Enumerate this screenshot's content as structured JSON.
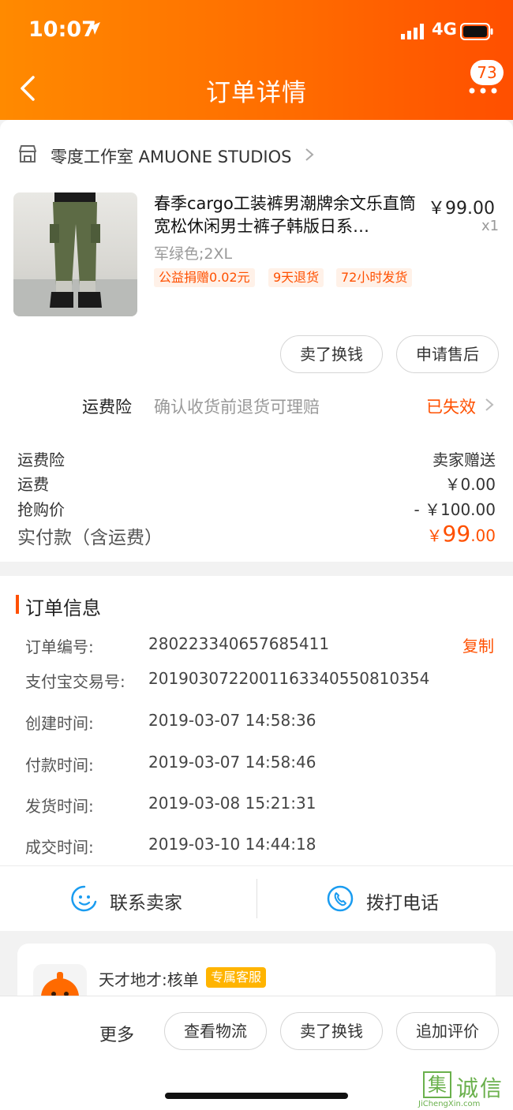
{
  "status_bar": {
    "time": "10:07",
    "network": "4G"
  },
  "header": {
    "title": "订单详情",
    "badge_count": "73"
  },
  "shop": {
    "name": "零度工作室 AMUONE STUDIOS"
  },
  "product": {
    "title": "春季cargo工装裤男潮牌余文乐直筒宽松休闲男士裤子韩版日系…",
    "price": "￥99.00",
    "qty": "x1",
    "sku": "军绿色;2XL",
    "tags": [
      "公益捐赠0.02元",
      "9天退货",
      "72小时发货"
    ]
  },
  "item_actions": {
    "sell_label": "卖了换钱",
    "after_sale_label": "申请售后"
  },
  "insurance": {
    "label": "运费险",
    "desc": "确认收货前退货可理赔",
    "status": "已失效"
  },
  "fees": [
    {
      "label": "运费险",
      "value": "卖家赠送"
    },
    {
      "label": "运费",
      "value": "￥0.00"
    },
    {
      "label": "抢购价",
      "value": "- ￥100.00"
    }
  ],
  "total": {
    "label": "实付款（含运费）",
    "currency": "￥",
    "integer": "99",
    "decimal": ".00"
  },
  "order_info": {
    "title": "订单信息",
    "copy_label": "复制",
    "rows": [
      {
        "label": "订单编号:",
        "value": "280223340657685411"
      },
      {
        "label": "支付宝交易号:",
        "value": "2019030722001163340550810354"
      },
      {
        "label": "创建时间:",
        "value": "2019-03-07 14:58:36"
      },
      {
        "label": "付款时间:",
        "value": "2019-03-07 14:58:46"
      },
      {
        "label": "发货时间:",
        "value": "2019-03-08 15:21:31"
      },
      {
        "label": "成交时间:",
        "value": "2019-03-10 14:44:18"
      }
    ]
  },
  "contact": {
    "seller_label": "联系卖家",
    "call_label": "拨打电话"
  },
  "customer_service": {
    "name": "天才地才:核单",
    "tag": "专属客服"
  },
  "bottom_bar": {
    "more_label": "更多",
    "buttons": [
      "查看物流",
      "卖了换钱",
      "追加评价"
    ]
  },
  "watermark": {
    "char": "集",
    "text": "诚信",
    "url": "JiChengXin.com"
  },
  "colors": {
    "accent": "#ff5000",
    "header_start": "#ff8a00",
    "header_end": "#ff4f00"
  }
}
